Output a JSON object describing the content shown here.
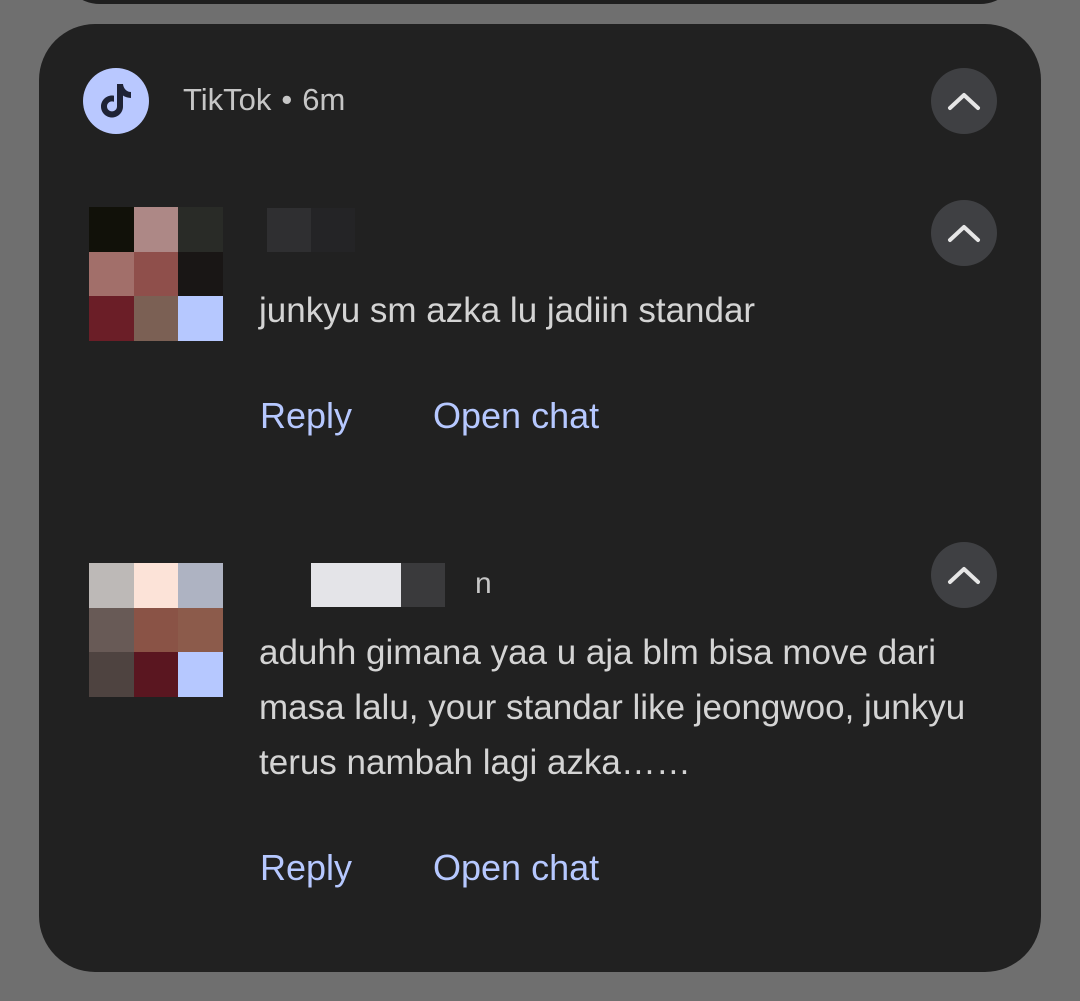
{
  "notification": {
    "app_name": "TikTok",
    "separator": "•",
    "time": "6m",
    "app_icon": "tiktok-icon",
    "collapse_icon": "chevron-up-icon"
  },
  "messages": [
    {
      "sender_visible_suffix": "",
      "text": "junkyu sm azka lu jadiin standar",
      "actions": {
        "reply": "Reply",
        "open_chat": "Open chat"
      },
      "avatar_colors": [
        "#111109",
        "#ad8886",
        "#292b27",
        "#a26f6a",
        "#8f4f4b",
        "#191615",
        "#6b1e27",
        "#7b6054",
        "#b6c8ff"
      ]
    },
    {
      "sender_visible_suffix": "n",
      "text": "aduhh gimana yaa u aja blm bisa move dari masa lalu, your standar like jeongwoo, junkyu terus nambah lagi azka……",
      "actions": {
        "reply": "Reply",
        "open_chat": "Open chat"
      },
      "avatar_colors": [
        "#bdb9b7",
        "#fce3d8",
        "#aeb3c2",
        "#685a56",
        "#8a5346",
        "#8c5b4b",
        "#4e4340",
        "#5a1620",
        "#b6c8ff"
      ]
    }
  ],
  "colors": {
    "background": "#6f6f6f",
    "card": "#212121",
    "accent": "#b6c8ff",
    "text": "#d4d4d4"
  }
}
